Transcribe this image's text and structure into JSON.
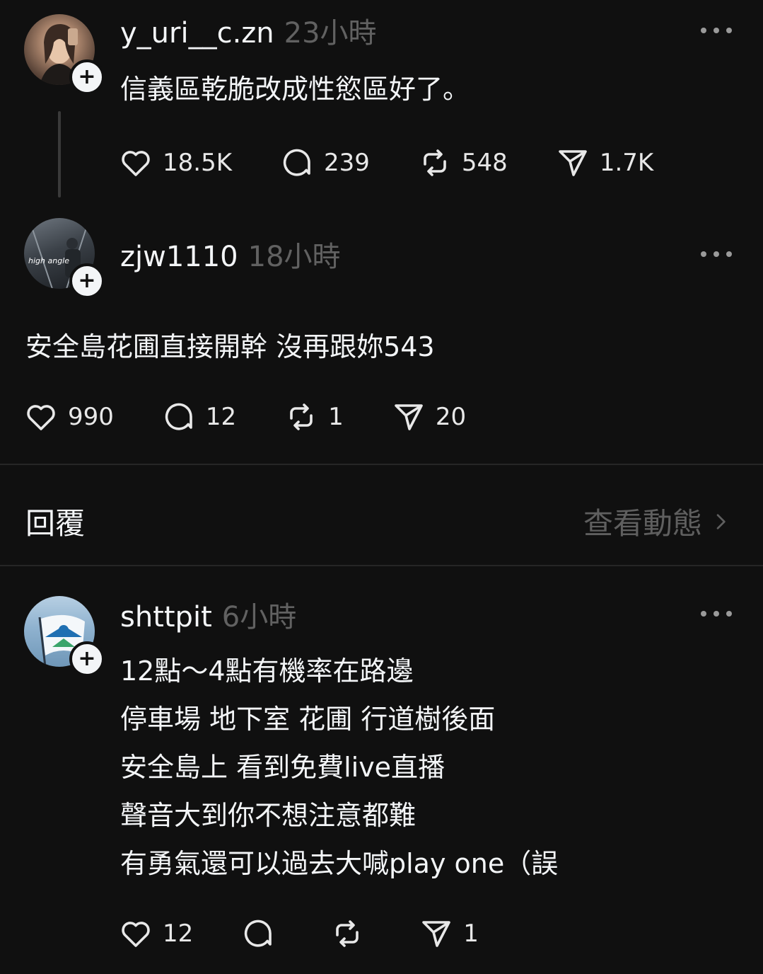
{
  "posts": [
    {
      "username": "y_uri__c.zn",
      "time": "23小時",
      "lines": [
        "信義區乾脆改成性慾區好了。"
      ],
      "likes": "18.5K",
      "comments": "239",
      "reposts": "548",
      "shares": "1.7K"
    },
    {
      "username": "zjw1110",
      "time": "18小時",
      "avatar_caption": "high angle",
      "lines": [
        "安全島花圃直接開幹 沒再跟妳543"
      ],
      "likes": "990",
      "comments": "12",
      "reposts": "1",
      "shares": "20"
    },
    {
      "username": "shttpit",
      "time": "6小時",
      "lines": [
        "12點～4點有機率在路邊",
        "停車場 地下室 花圃 行道樹後面",
        "安全島上 看到免費live直播",
        "聲音大到你不想注意都難",
        "有勇氣還可以過去大喊play one（誤"
      ],
      "likes": "12",
      "comments": "",
      "reposts": "",
      "shares": "1"
    }
  ],
  "replies_header": {
    "title": "回覆",
    "view_activity": "查看動態"
  },
  "colors": {
    "background": "#101010",
    "text": "#f3f5f7",
    "muted": "#616161"
  }
}
